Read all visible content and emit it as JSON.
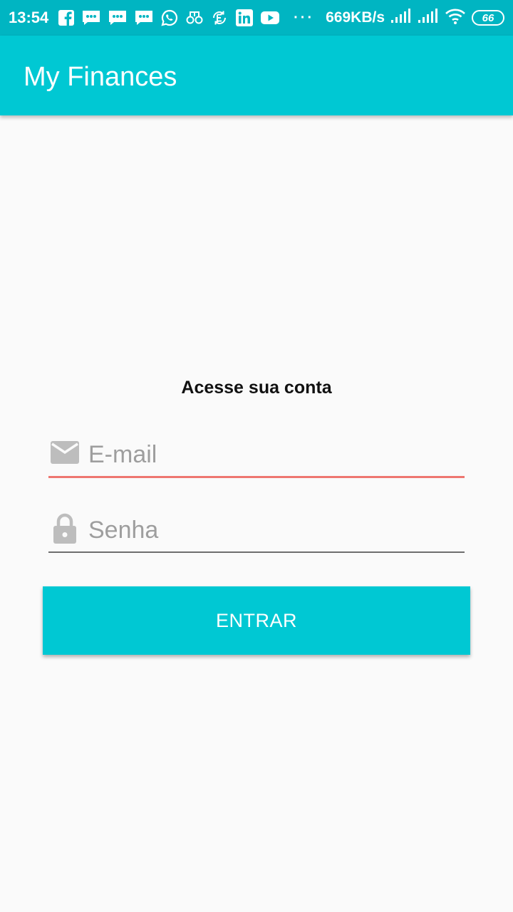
{
  "status_bar": {
    "time": "13:54",
    "dots": "···",
    "network_speed": "669KB/s",
    "battery_level": "66",
    "notification_icons": [
      "facebook-icon",
      "messages-icon",
      "messages-icon",
      "messages-icon",
      "whatsapp-icon",
      "cloud-app-icon",
      "sync-e-icon",
      "linkedin-icon",
      "youtube-icon"
    ],
    "system_icons": [
      "signal-icon",
      "signal-icon",
      "wifi-icon",
      "battery-icon"
    ]
  },
  "app_bar": {
    "title": "My Finances"
  },
  "login": {
    "heading": "Acesse sua conta",
    "email": {
      "placeholder": "E-mail",
      "value": "",
      "icon": "email-icon"
    },
    "password": {
      "placeholder": "Senha",
      "value": "",
      "icon": "lock-icon"
    },
    "submit_label": "ENTRAR"
  },
  "colors": {
    "status_bar": "#00b5c2",
    "app_bar": "#00c8d3",
    "button": "#00c8d3",
    "focused_underline": "#ee7670",
    "background": "#fafafa"
  }
}
